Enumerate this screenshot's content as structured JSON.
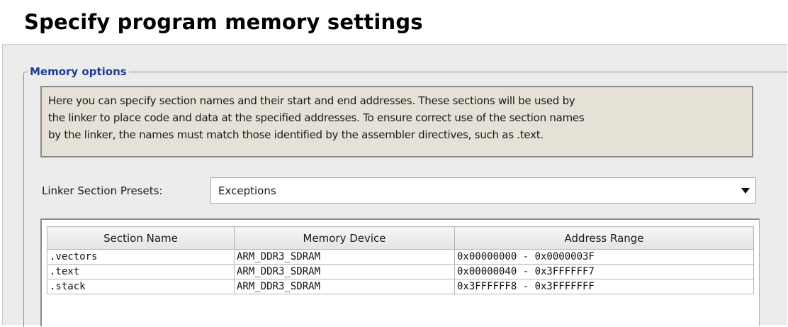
{
  "page": {
    "title": "Specify program memory settings"
  },
  "memory_options": {
    "legend": "Memory options",
    "description_lines": [
      "Here you can specify section names and their start and end addresses. These sections will be used by",
      "the linker to place code and data at the specified addresses. To ensure correct use of the section names",
      "by the linker, the names must match those identified by the assembler directives, such as .text."
    ],
    "presets": {
      "label": "Linker Section Presets:",
      "selected": "Exceptions"
    },
    "table": {
      "columns": [
        "Section Name",
        "Memory Device",
        "Address Range"
      ],
      "rows": [
        [
          ".vectors",
          "ARM_DDR3_SDRAM",
          "0x00000000 - 0x0000003F"
        ],
        [
          ".text",
          "ARM_DDR3_SDRAM",
          "0x00000040 - 0x3FFFFFF7"
        ],
        [
          ".stack",
          "ARM_DDR3_SDRAM",
          "0x3FFFFFF8 - 0x3FFFFFFF"
        ]
      ]
    }
  },
  "icons": {
    "dropdown": "chevron-down-icon"
  }
}
